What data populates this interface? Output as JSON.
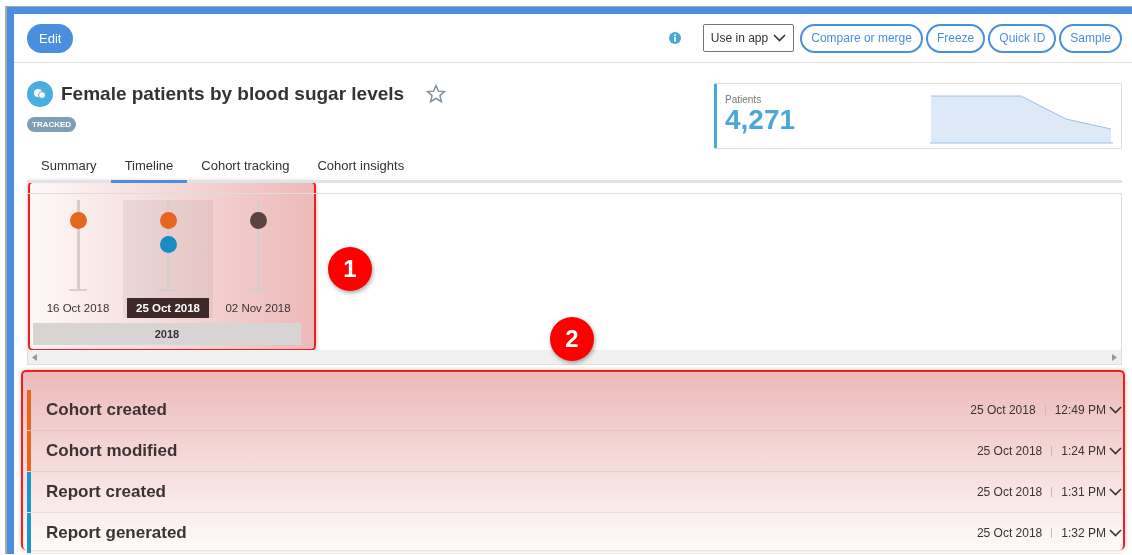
{
  "toolbar": {
    "edit_button": "Edit",
    "use_in_app": "Use in app",
    "buttons": [
      "Compare or merge",
      "Freeze",
      "Quick ID",
      "Sample"
    ]
  },
  "header": {
    "title": "Female patients by blood sugar levels",
    "starred": false,
    "badge": "TRACKED"
  },
  "patients_card": {
    "label": "Patients",
    "value": "4,271"
  },
  "tabs": [
    {
      "label": "Summary",
      "selected": false
    },
    {
      "label": "Timeline",
      "selected": true
    },
    {
      "label": "Cohort tracking",
      "selected": false
    },
    {
      "label": "Cohort insights",
      "selected": false
    }
  ],
  "timeline": {
    "dates": [
      {
        "label": "16 Oct 2018",
        "selected": false,
        "events": [
          {
            "color": "#e5661e"
          }
        ]
      },
      {
        "label": "25 Oct 2018",
        "selected": true,
        "events": [
          {
            "color": "#e5661e"
          },
          {
            "color": "#1b8bc4"
          }
        ]
      },
      {
        "label": "02 Nov 2018",
        "selected": false,
        "events": [
          {
            "color": "#5c4343"
          }
        ]
      }
    ],
    "year": "2018"
  },
  "events": [
    {
      "title": "Cohort created",
      "date": "25 Oct 2018",
      "time": "12:49 PM",
      "color": "#e5661e",
      "expanded": false
    },
    {
      "title": "Cohort modified",
      "date": "25 Oct 2018",
      "time": "1:24 PM",
      "color": "#e5661e",
      "expanded": false
    },
    {
      "title": "Report created",
      "date": "25 Oct 2018",
      "time": "1:31 PM",
      "color": "#1a96d0",
      "expanded": false
    },
    {
      "title": "Report generated",
      "date": "25 Oct 2018",
      "time": "1:32 PM",
      "color": "#1a96d0",
      "expanded": false
    }
  ],
  "annotations": [
    {
      "label": "1"
    },
    {
      "label": "2"
    }
  ]
}
